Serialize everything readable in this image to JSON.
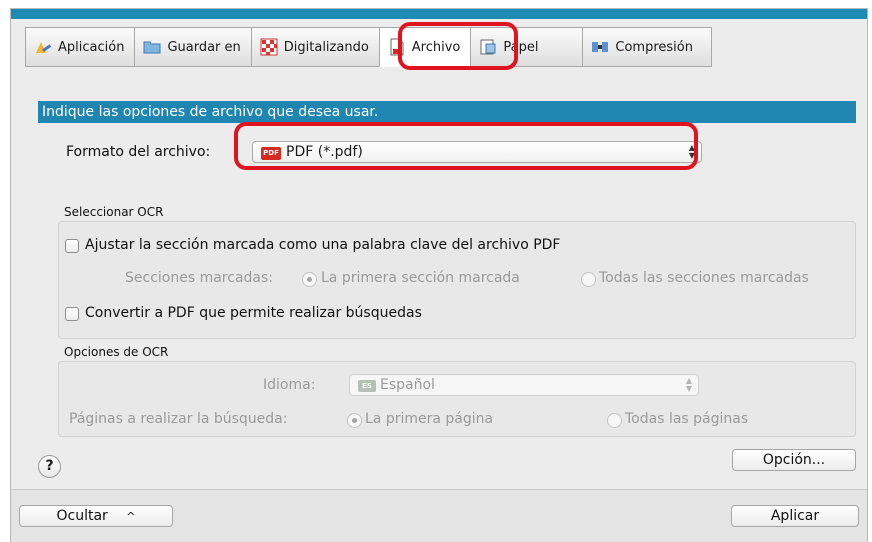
{
  "tabs": [
    {
      "label": "Aplicación",
      "icon": "application-icon"
    },
    {
      "label": "Guardar en",
      "icon": "folder-icon"
    },
    {
      "label": "Digitalizando",
      "icon": "scanning-icon"
    },
    {
      "label": "Archivo",
      "icon": "file-icon",
      "active": true
    },
    {
      "label": "Papel",
      "icon": "paper-icon"
    },
    {
      "label": "Compresión",
      "icon": "compression-icon"
    }
  ],
  "header": {
    "instruction": "Indique las opciones de archivo que desea usar."
  },
  "file_format": {
    "label": "Formato del archivo:",
    "badge": "PDF",
    "value": "PDF (*.pdf)"
  },
  "ocr_select": {
    "group_label": "Seleccionar OCR",
    "keyword_checkbox": "Ajustar la sección marcada como una palabra clave del archivo PDF",
    "marked_sections_label": "Secciones marcadas:",
    "first_section": "La primera sección marcada",
    "all_sections": "Todas las secciones marcadas",
    "searchable_checkbox": "Convertir a PDF que permite realizar búsquedas"
  },
  "ocr_options": {
    "group_label": "Opciones de OCR",
    "language_label": "Idioma:",
    "language_badge": "ES",
    "language_value": "Español",
    "pages_label": "Páginas a realizar la búsqueda:",
    "first_page": "La primera página",
    "all_pages": "Todas las páginas"
  },
  "buttons": {
    "help": "?",
    "option": "Opción...",
    "hide": "Ocultar",
    "hide_chevron": "^",
    "apply": "Aplicar"
  },
  "colors": {
    "accent_blue": "#1f86b2",
    "highlight_red": "#e0141e"
  }
}
